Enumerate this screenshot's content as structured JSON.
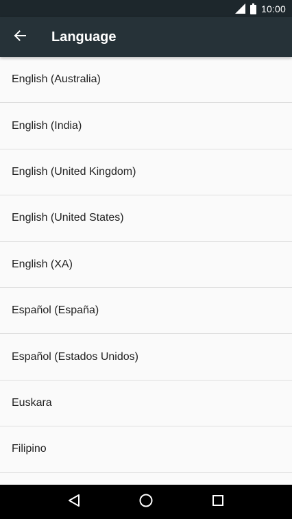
{
  "status_bar": {
    "time": "10:00",
    "icons": [
      "signal-icon",
      "battery-icon"
    ]
  },
  "app_bar": {
    "title": "Language",
    "back_icon": "arrow-left-icon"
  },
  "languages": [
    {
      "label": "English (Australia)"
    },
    {
      "label": "English (India)"
    },
    {
      "label": "English (United Kingdom)"
    },
    {
      "label": "English (United States)"
    },
    {
      "label": "English (XA)"
    },
    {
      "label": "Español (España)"
    },
    {
      "label": "Español (Estados Unidos)"
    },
    {
      "label": "Euskara"
    },
    {
      "label": "Filipino"
    },
    {
      "label": ""
    }
  ],
  "nav_bar": {
    "icons": [
      "back-triangle-icon",
      "home-circle-icon",
      "recents-square-icon"
    ]
  },
  "colors": {
    "status_bar": "#1d272c",
    "app_bar": "#263238",
    "background": "#fafafa",
    "divider": "#dedede",
    "nav_bar": "#000000"
  }
}
